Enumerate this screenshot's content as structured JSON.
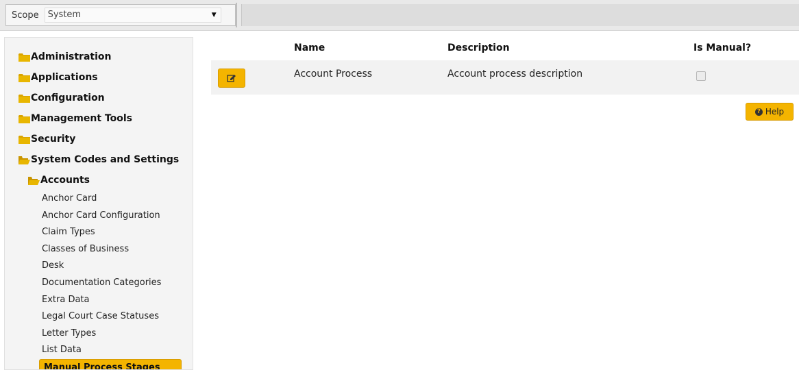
{
  "scope": {
    "label": "Scope",
    "value": "System",
    "caret": "▼"
  },
  "sidebar": {
    "top_items": [
      {
        "label": "Administration",
        "icon": "folder-closed-icon"
      },
      {
        "label": "Applications",
        "icon": "folder-closed-icon"
      },
      {
        "label": "Configuration",
        "icon": "folder-closed-icon"
      },
      {
        "label": "Management Tools",
        "icon": "folder-closed-icon"
      },
      {
        "label": "Security",
        "icon": "folder-closed-icon"
      },
      {
        "label": "System Codes and Settings",
        "icon": "folder-open-icon"
      }
    ],
    "sub_item": {
      "label": "Accounts",
      "icon": "folder-open-icon"
    },
    "leaves": [
      "Anchor Card",
      "Anchor Card Configuration",
      "Claim Types",
      "Classes of Business",
      "Desk",
      "Documentation Categories",
      "Extra Data",
      "Legal Court Case Statuses",
      "Letter Types",
      "List Data",
      "Manual Process Stages"
    ],
    "active_leaf": "Manual Process Stages"
  },
  "table": {
    "headers": {
      "name": "Name",
      "description": "Description",
      "is_manual": "Is Manual?"
    },
    "rows": [
      {
        "name": "Account Process",
        "description": "Account process description",
        "is_manual": false
      }
    ]
  },
  "help": {
    "label": "Help",
    "icon": "question-circle-icon"
  },
  "colors": {
    "accent": "#f4b400",
    "folder": "#d9a400"
  }
}
